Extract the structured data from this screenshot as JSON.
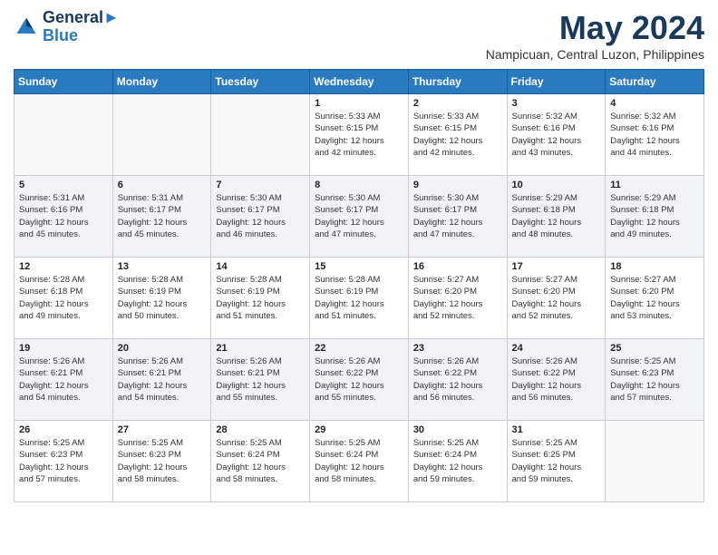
{
  "header": {
    "logo_line1": "General",
    "logo_line2": "Blue",
    "month": "May 2024",
    "location": "Nampicuan, Central Luzon, Philippines"
  },
  "weekdays": [
    "Sunday",
    "Monday",
    "Tuesday",
    "Wednesday",
    "Thursday",
    "Friday",
    "Saturday"
  ],
  "weeks": [
    [
      {
        "day": "",
        "info": ""
      },
      {
        "day": "",
        "info": ""
      },
      {
        "day": "",
        "info": ""
      },
      {
        "day": "1",
        "info": "Sunrise: 5:33 AM\nSunset: 6:15 PM\nDaylight: 12 hours\nand 42 minutes."
      },
      {
        "day": "2",
        "info": "Sunrise: 5:33 AM\nSunset: 6:15 PM\nDaylight: 12 hours\nand 42 minutes."
      },
      {
        "day": "3",
        "info": "Sunrise: 5:32 AM\nSunset: 6:16 PM\nDaylight: 12 hours\nand 43 minutes."
      },
      {
        "day": "4",
        "info": "Sunrise: 5:32 AM\nSunset: 6:16 PM\nDaylight: 12 hours\nand 44 minutes."
      }
    ],
    [
      {
        "day": "5",
        "info": "Sunrise: 5:31 AM\nSunset: 6:16 PM\nDaylight: 12 hours\nand 45 minutes."
      },
      {
        "day": "6",
        "info": "Sunrise: 5:31 AM\nSunset: 6:17 PM\nDaylight: 12 hours\nand 45 minutes."
      },
      {
        "day": "7",
        "info": "Sunrise: 5:30 AM\nSunset: 6:17 PM\nDaylight: 12 hours\nand 46 minutes."
      },
      {
        "day": "8",
        "info": "Sunrise: 5:30 AM\nSunset: 6:17 PM\nDaylight: 12 hours\nand 47 minutes."
      },
      {
        "day": "9",
        "info": "Sunrise: 5:30 AM\nSunset: 6:17 PM\nDaylight: 12 hours\nand 47 minutes."
      },
      {
        "day": "10",
        "info": "Sunrise: 5:29 AM\nSunset: 6:18 PM\nDaylight: 12 hours\nand 48 minutes."
      },
      {
        "day": "11",
        "info": "Sunrise: 5:29 AM\nSunset: 6:18 PM\nDaylight: 12 hours\nand 49 minutes."
      }
    ],
    [
      {
        "day": "12",
        "info": "Sunrise: 5:28 AM\nSunset: 6:18 PM\nDaylight: 12 hours\nand 49 minutes."
      },
      {
        "day": "13",
        "info": "Sunrise: 5:28 AM\nSunset: 6:19 PM\nDaylight: 12 hours\nand 50 minutes."
      },
      {
        "day": "14",
        "info": "Sunrise: 5:28 AM\nSunset: 6:19 PM\nDaylight: 12 hours\nand 51 minutes."
      },
      {
        "day": "15",
        "info": "Sunrise: 5:28 AM\nSunset: 6:19 PM\nDaylight: 12 hours\nand 51 minutes."
      },
      {
        "day": "16",
        "info": "Sunrise: 5:27 AM\nSunset: 6:20 PM\nDaylight: 12 hours\nand 52 minutes."
      },
      {
        "day": "17",
        "info": "Sunrise: 5:27 AM\nSunset: 6:20 PM\nDaylight: 12 hours\nand 52 minutes."
      },
      {
        "day": "18",
        "info": "Sunrise: 5:27 AM\nSunset: 6:20 PM\nDaylight: 12 hours\nand 53 minutes."
      }
    ],
    [
      {
        "day": "19",
        "info": "Sunrise: 5:26 AM\nSunset: 6:21 PM\nDaylight: 12 hours\nand 54 minutes."
      },
      {
        "day": "20",
        "info": "Sunrise: 5:26 AM\nSunset: 6:21 PM\nDaylight: 12 hours\nand 54 minutes."
      },
      {
        "day": "21",
        "info": "Sunrise: 5:26 AM\nSunset: 6:21 PM\nDaylight: 12 hours\nand 55 minutes."
      },
      {
        "day": "22",
        "info": "Sunrise: 5:26 AM\nSunset: 6:22 PM\nDaylight: 12 hours\nand 55 minutes."
      },
      {
        "day": "23",
        "info": "Sunrise: 5:26 AM\nSunset: 6:22 PM\nDaylight: 12 hours\nand 56 minutes."
      },
      {
        "day": "24",
        "info": "Sunrise: 5:26 AM\nSunset: 6:22 PM\nDaylight: 12 hours\nand 56 minutes."
      },
      {
        "day": "25",
        "info": "Sunrise: 5:25 AM\nSunset: 6:23 PM\nDaylight: 12 hours\nand 57 minutes."
      }
    ],
    [
      {
        "day": "26",
        "info": "Sunrise: 5:25 AM\nSunset: 6:23 PM\nDaylight: 12 hours\nand 57 minutes."
      },
      {
        "day": "27",
        "info": "Sunrise: 5:25 AM\nSunset: 6:23 PM\nDaylight: 12 hours\nand 58 minutes."
      },
      {
        "day": "28",
        "info": "Sunrise: 5:25 AM\nSunset: 6:24 PM\nDaylight: 12 hours\nand 58 minutes."
      },
      {
        "day": "29",
        "info": "Sunrise: 5:25 AM\nSunset: 6:24 PM\nDaylight: 12 hours\nand 58 minutes."
      },
      {
        "day": "30",
        "info": "Sunrise: 5:25 AM\nSunset: 6:24 PM\nDaylight: 12 hours\nand 59 minutes."
      },
      {
        "day": "31",
        "info": "Sunrise: 5:25 AM\nSunset: 6:25 PM\nDaylight: 12 hours\nand 59 minutes."
      },
      {
        "day": "",
        "info": ""
      }
    ]
  ]
}
